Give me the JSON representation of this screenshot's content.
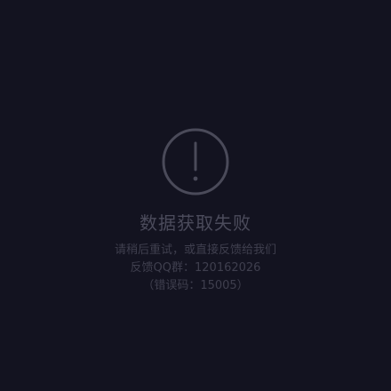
{
  "error": {
    "icon": "exclamation-circle-icon",
    "title": "数据获取失败",
    "line1": "请稍后重试，或直接反馈给我们",
    "line2": "反馈QQ群：120162026",
    "line3": "（错误码：15005）"
  },
  "colors": {
    "background": "#131320",
    "icon": "#4a4a59",
    "title": "#4b4b5b",
    "description": "#3f3f4e"
  }
}
